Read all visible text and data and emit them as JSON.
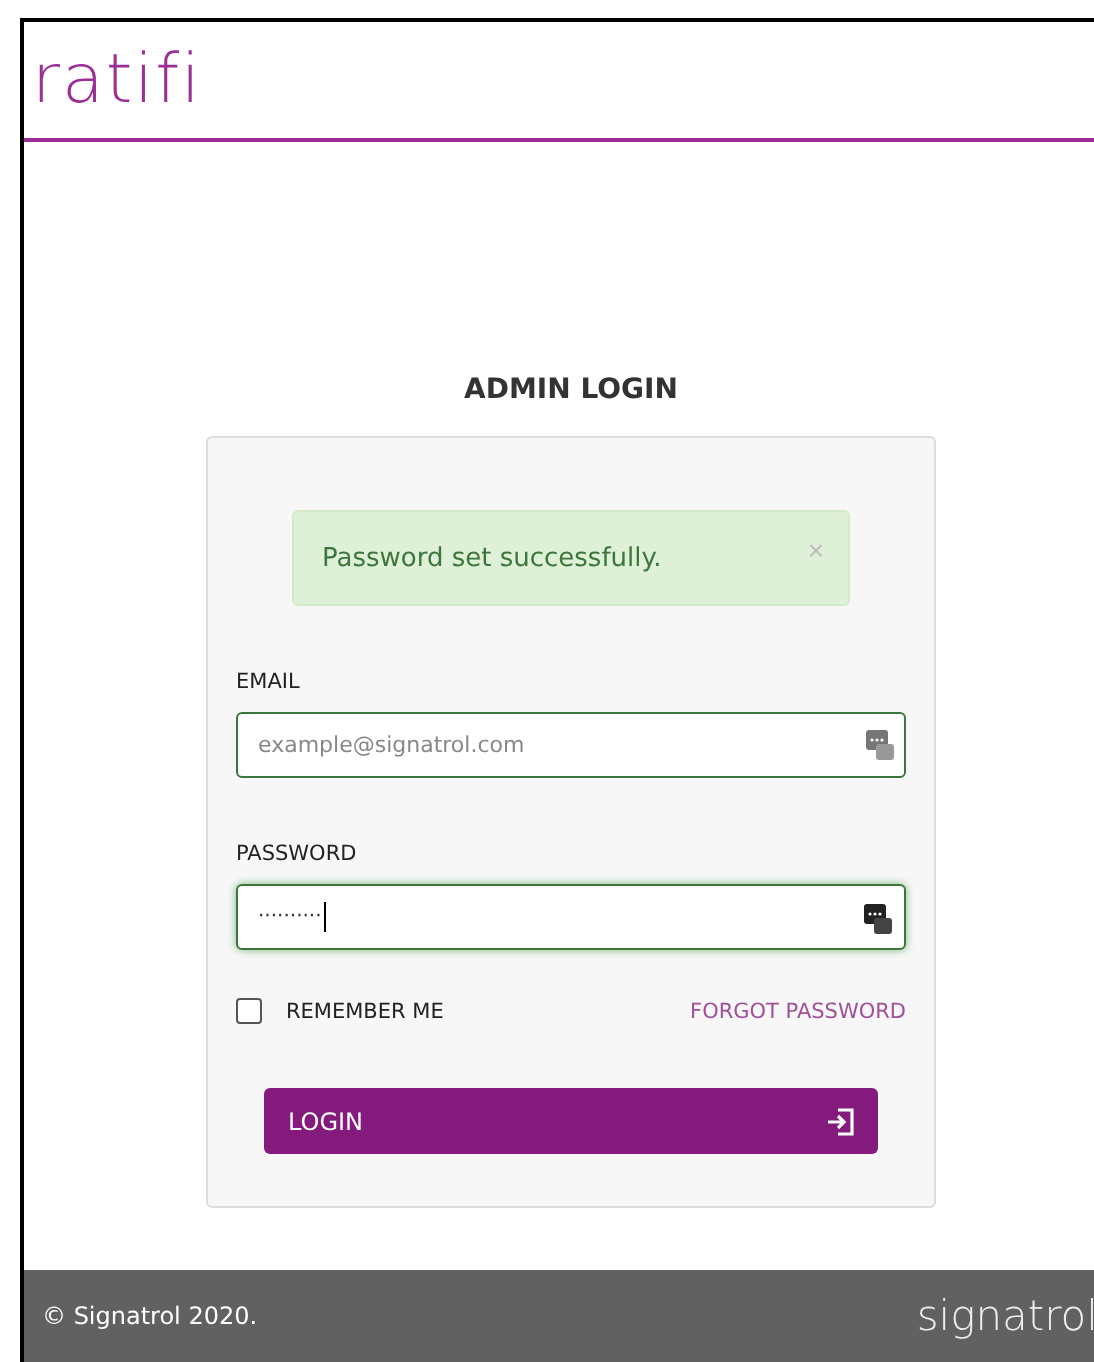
{
  "header": {
    "logo": "ratifi"
  },
  "login": {
    "title": "ADMIN LOGIN",
    "alert": {
      "message": "Password set successfully.",
      "close": "×"
    },
    "email": {
      "label": "EMAIL",
      "placeholder": "example@signatrol.com",
      "focused": false
    },
    "password": {
      "label": "PASSWORD",
      "value": "··········",
      "focused": true
    },
    "remember": {
      "label": "REMEMBER ME",
      "checked": false
    },
    "forgot": "FORGOT PASSWORD",
    "button": "LOGIN"
  },
  "footer": {
    "copyright": "© Signatrol 2020.",
    "logo": "signatrol"
  }
}
